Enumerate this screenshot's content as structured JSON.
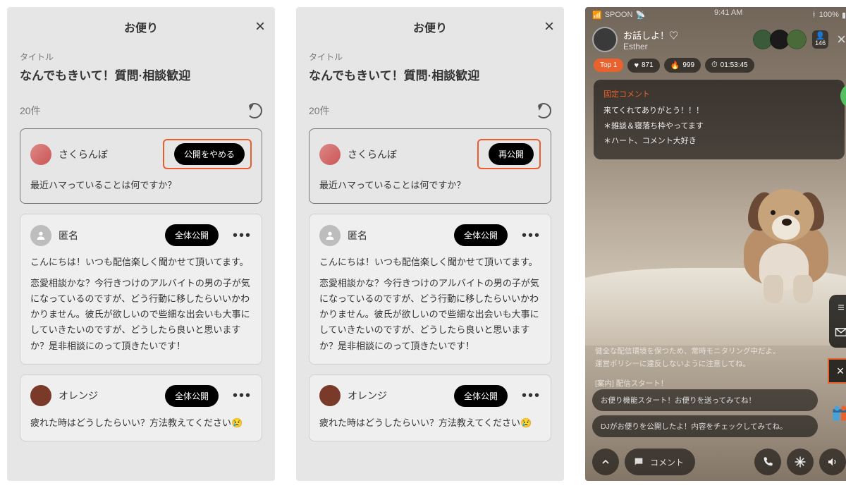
{
  "panel_a": {
    "header_title": "お便り",
    "subtitle_label": "タイトル",
    "subtitle": "なんでもきいて！質問·相談歓迎",
    "count_text": "20件",
    "card1": {
      "name": "さくらんぼ",
      "action_button": "公開をやめる",
      "body": "最近ハマっていることは何ですか？"
    },
    "card2": {
      "name": "匿名",
      "action_button": "全体公開",
      "line1": "こんにちは！いつも配信楽しく聞かせて頂いてます。",
      "line2": "恋愛相談かな？今行きつけのアルバイトの男の子が気になっているのですが、どう行動に移したらいいかわかりません。彼氏が欲しいので些細な出会いも大事にしていきたいのですが、どうしたら良いと思いますか？是非相談にのって頂きたいです！"
    },
    "card3": {
      "name": "オレンジ",
      "action_button": "全体公開",
      "body": "疲れた時はどうしたらいい？方法教えてください😢"
    }
  },
  "panel_b": {
    "header_title": "お便り",
    "subtitle_label": "タイトル",
    "subtitle": "なんでもきいて！質問·相談歓迎",
    "count_text": "20件",
    "card1": {
      "name": "さくらんぼ",
      "action_button": "再公開",
      "body": "最近ハマっていることは何ですか？"
    },
    "card2": {
      "name": "匿名",
      "action_button": "全体公開",
      "line1": "こんにちは！いつも配信楽しく聞かせて頂いてます。",
      "line2": "恋愛相談かな？今行きつけのアルバイトの男の子が気になっているのですが、どう行動に移したらいいかわかりません。彼氏が欲しいので些細な出会いも大事にしていきたいのですが、どうしたら良いと思いますか？是非相談にのって頂きたいです！"
    },
    "card3": {
      "name": "オレンジ",
      "action_button": "全体公開",
      "body": "疲れた時はどうしたらいい？方法教えてください😢"
    }
  },
  "panel_c": {
    "status_carrier": "SPOON",
    "status_time": "9:41 AM",
    "status_battery": "100%",
    "live_title": "お話しよ！♡",
    "live_name": "Esther",
    "listener_count": "146",
    "badges": {
      "top": "Top 1",
      "hearts": "871",
      "fire": "999",
      "time": "01:53:45"
    },
    "pinned": {
      "title": "固定コメント",
      "l1": "来てくれてありがとう！！！",
      "l2": "＊雑談＆寝落ち枠やってます",
      "l3": "＊ハート、コメント大好き"
    },
    "notice": {
      "l1": "健全な配信環境を保つため、常時モニタリング中だよ。",
      "l2": "運営ポリシーに違反しないように注意してね。",
      "l3": "[案内] 配信スタート！"
    },
    "chat": {
      "b1": "お便り機能スタート！お便りを送ってみてね！",
      "b2": "DJがお便りを公開したよ！内容をチェックしてみてね。"
    },
    "comment_placeholder": "コメント"
  }
}
